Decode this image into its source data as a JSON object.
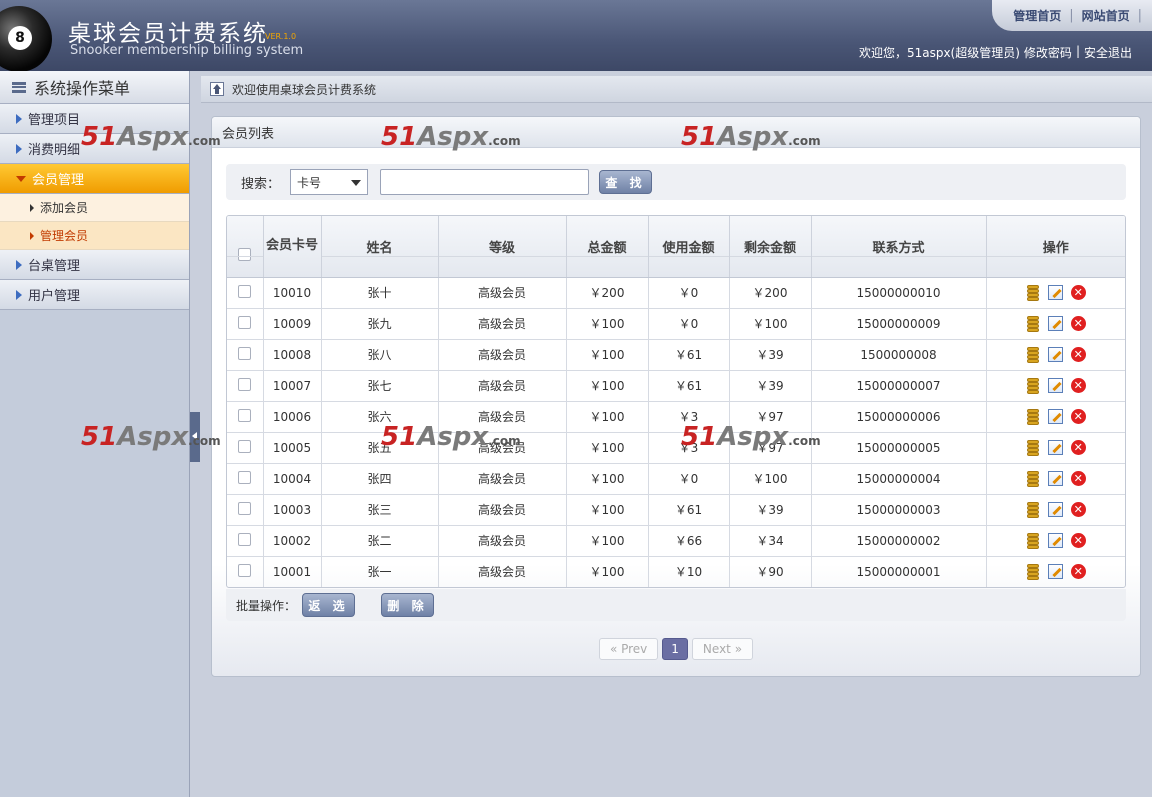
{
  "header": {
    "title_cn": "桌球会员计费系统",
    "version": "VER.1.0",
    "title_en": "Snooker membership billing system",
    "logo_number": "8",
    "nav": [
      "管理首页",
      "网站首页"
    ],
    "user_greeting": "欢迎您，51aspx(超级管理员)",
    "change_password": "修改密码",
    "logout": "安全退出",
    "separator": "|"
  },
  "sidebar": {
    "title": "系统操作菜单",
    "items": [
      {
        "label": "管理项目"
      },
      {
        "label": "消费明细"
      },
      {
        "label": "会员管理",
        "active": true,
        "children": [
          {
            "label": "添加会员"
          },
          {
            "label": "管理会员",
            "current": true
          }
        ]
      },
      {
        "label": "台桌管理"
      },
      {
        "label": "用户管理"
      }
    ]
  },
  "breadcrumb": "欢迎使用桌球会员计费系统",
  "panel": {
    "title": "会员列表",
    "search": {
      "label": "搜索：",
      "select_value": "卡号",
      "input_value": "",
      "button": "查 找"
    },
    "table": {
      "columns": [
        "",
        "会员卡号",
        "姓名",
        "等级",
        "总金额",
        "使用金额",
        "剩余金额",
        "联系方式",
        "操作"
      ],
      "rows": [
        [
          "10010",
          "张十",
          "高级会员",
          "￥200",
          "￥0",
          "￥200",
          "15000000010"
        ],
        [
          "10009",
          "张九",
          "高级会员",
          "￥100",
          "￥0",
          "￥100",
          "15000000009"
        ],
        [
          "10008",
          "张八",
          "高级会员",
          "￥100",
          "￥61",
          "￥39",
          "1500000008"
        ],
        [
          "10007",
          "张七",
          "高级会员",
          "￥100",
          "￥61",
          "￥39",
          "15000000007"
        ],
        [
          "10006",
          "张六",
          "高级会员",
          "￥100",
          "￥3",
          "￥97",
          "15000000006"
        ],
        [
          "10005",
          "张五",
          "高级会员",
          "￥100",
          "￥3",
          "￥97",
          "15000000005"
        ],
        [
          "10004",
          "张四",
          "高级会员",
          "￥100",
          "￥0",
          "￥100",
          "15000000004"
        ],
        [
          "10003",
          "张三",
          "高级会员",
          "￥100",
          "￥61",
          "￥39",
          "15000000003"
        ],
        [
          "10002",
          "张二",
          "高级会员",
          "￥100",
          "￥66",
          "￥34",
          "15000000002"
        ],
        [
          "10001",
          "张一",
          "高级会员",
          "￥100",
          "￥10",
          "￥90",
          "15000000001"
        ]
      ]
    },
    "batch": {
      "label": "批量操作：",
      "invert_button": "返 选",
      "delete_button": "删 除"
    },
    "pager": {
      "prev": "« Prev",
      "current": "1",
      "next": "Next »"
    }
  },
  "watermark": {
    "part1": "51",
    "part2": "Aspx",
    "part3": ".com"
  },
  "colors": {
    "header": "#4a5676",
    "active_menu": "#f09c00",
    "current_page": "#6a6ea3",
    "delete": "#e02020"
  }
}
